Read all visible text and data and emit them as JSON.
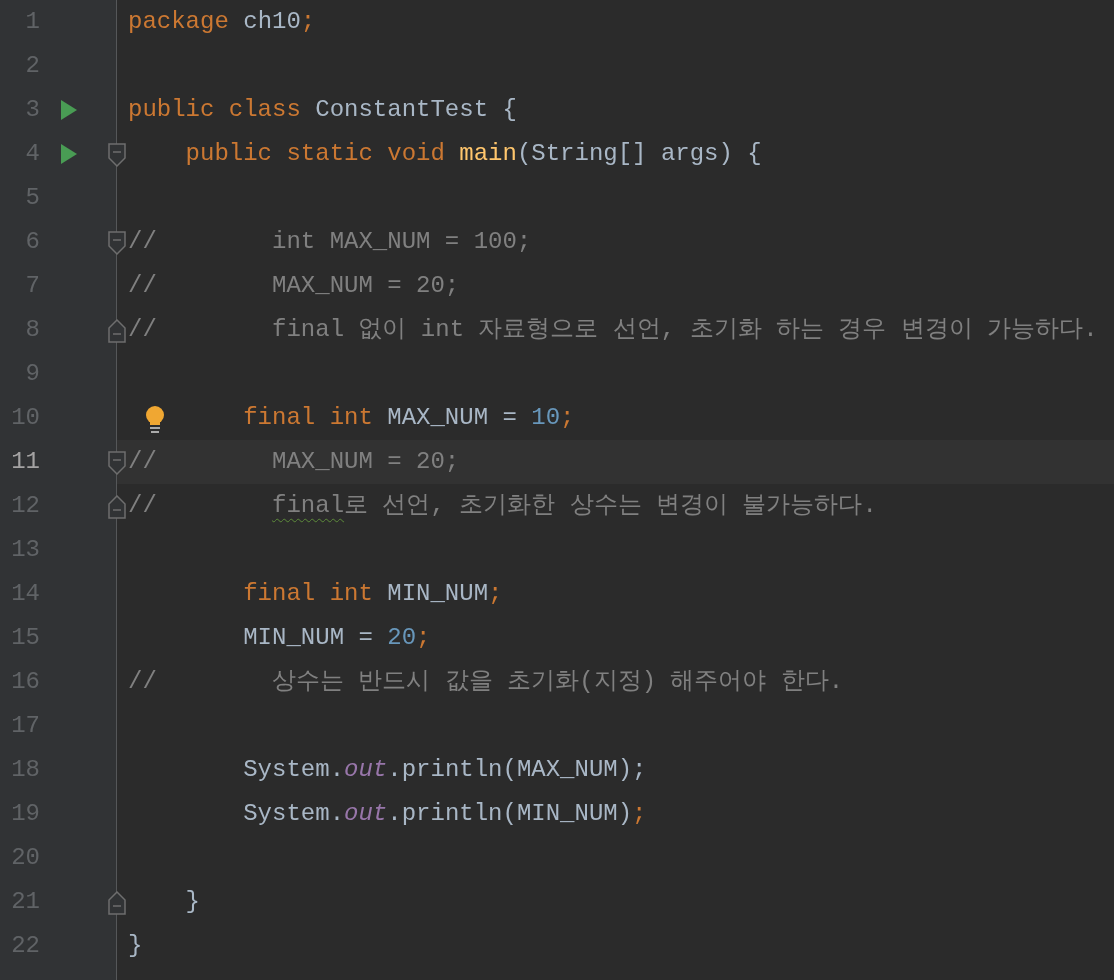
{
  "lines": [
    {
      "number": "1",
      "run": false,
      "fold_start": false,
      "fold_end": false,
      "bulb": false,
      "current": false,
      "tokens": [
        {
          "kind": "keyword",
          "text": "package"
        },
        {
          "kind": "plain",
          "text": " ch10"
        },
        {
          "kind": "punct",
          "text": ";"
        }
      ]
    },
    {
      "number": "2",
      "run": false,
      "fold_start": false,
      "fold_end": false,
      "bulb": false,
      "current": false
    },
    {
      "number": "3",
      "run": true,
      "fold_start": false,
      "fold_end": false,
      "bulb": false,
      "current": false,
      "tokens": [
        {
          "kind": "keyword",
          "text": "public class"
        },
        {
          "kind": "plain",
          "text": " ConstantTest {"
        }
      ]
    },
    {
      "number": "4",
      "run": true,
      "fold_start": true,
      "fold_end": false,
      "bulb": false,
      "current": false,
      "tokens": [
        {
          "kind": "keyword",
          "text": "    public static void"
        },
        {
          "kind": "method",
          "text": " main"
        },
        {
          "kind": "plain",
          "text": "(String[] args) {"
        }
      ]
    },
    {
      "number": "5",
      "run": false,
      "fold_start": false,
      "fold_end": false,
      "bulb": false,
      "current": false
    },
    {
      "number": "6",
      "run": false,
      "fold_start": true,
      "fold_end": false,
      "bulb": false,
      "current": false,
      "tokens": [
        {
          "kind": "comment",
          "text": "//        int MAX_NUM = 100;"
        }
      ]
    },
    {
      "number": "7",
      "run": false,
      "fold_start": false,
      "fold_end": false,
      "bulb": false,
      "current": false,
      "tokens": [
        {
          "kind": "comment",
          "text": "//        MAX_NUM = 20;"
        }
      ]
    },
    {
      "number": "8",
      "run": false,
      "fold_start": false,
      "fold_end": true,
      "bulb": false,
      "current": false,
      "tokens": [
        {
          "kind": "comment",
          "text": "//        final 없이 int 자료형으로 선언, 초기화 하는 경우 변경이 가능하다."
        }
      ]
    },
    {
      "number": "9",
      "run": false,
      "fold_start": false,
      "fold_end": false,
      "bulb": false,
      "current": false
    },
    {
      "number": "10",
      "run": false,
      "fold_start": false,
      "fold_end": false,
      "bulb": true,
      "current": false,
      "tokens": [
        {
          "kind": "keyword",
          "text": "        final int"
        },
        {
          "kind": "plain",
          "text": " MAX_NUM = "
        },
        {
          "kind": "number",
          "text": "10"
        },
        {
          "kind": "punct",
          "text": ";"
        }
      ]
    },
    {
      "number": "11",
      "run": false,
      "fold_start": true,
      "fold_end": false,
      "bulb": false,
      "current": true,
      "tokens": [
        {
          "kind": "comment",
          "text": "//        MAX_NUM = 20;"
        }
      ]
    },
    {
      "number": "12",
      "run": false,
      "fold_start": false,
      "fold_end": true,
      "bulb": false,
      "current": false,
      "tokens": [
        {
          "kind": "comment",
          "text": "//        "
        },
        {
          "kind": "comment",
          "text": "final",
          "warning": true
        },
        {
          "kind": "comment",
          "text": "로 선언, 초기화한 상수는 변경이 불가능하다."
        }
      ]
    },
    {
      "number": "13",
      "run": false,
      "fold_start": false,
      "fold_end": false,
      "bulb": false,
      "current": false
    },
    {
      "number": "14",
      "run": false,
      "fold_start": false,
      "fold_end": false,
      "bulb": false,
      "current": false,
      "tokens": [
        {
          "kind": "keyword",
          "text": "        final int"
        },
        {
          "kind": "plain",
          "text": " MIN_NUM"
        },
        {
          "kind": "punct",
          "text": ";"
        }
      ]
    },
    {
      "number": "15",
      "run": false,
      "fold_start": false,
      "fold_end": false,
      "bulb": false,
      "current": false,
      "tokens": [
        {
          "kind": "plain",
          "text": "        MIN_NUM = "
        },
        {
          "kind": "number",
          "text": "20"
        },
        {
          "kind": "punct",
          "text": ";"
        }
      ]
    },
    {
      "number": "16",
      "run": false,
      "fold_start": false,
      "fold_end": false,
      "bulb": false,
      "current": false,
      "tokens": [
        {
          "kind": "comment",
          "text": "//        상수는 반드시 값을 초기화(지정) 해주어야 한다."
        }
      ]
    },
    {
      "number": "17",
      "run": false,
      "fold_start": false,
      "fold_end": false,
      "bulb": false,
      "current": false
    },
    {
      "number": "18",
      "run": false,
      "fold_start": false,
      "fold_end": false,
      "bulb": false,
      "current": false,
      "tokens": [
        {
          "kind": "plain",
          "text": "        System."
        },
        {
          "kind": "field",
          "text": "out"
        },
        {
          "kind": "plain",
          "text": ".println(MAX_NUM);"
        }
      ]
    },
    {
      "number": "19",
      "run": false,
      "fold_start": false,
      "fold_end": false,
      "bulb": false,
      "current": false,
      "tokens": [
        {
          "kind": "plain",
          "text": "        System."
        },
        {
          "kind": "field",
          "text": "out"
        },
        {
          "kind": "plain",
          "text": ".println(MIN_NUM)"
        },
        {
          "kind": "punct",
          "text": ";"
        }
      ]
    },
    {
      "number": "20",
      "run": false,
      "fold_start": false,
      "fold_end": false,
      "bulb": false,
      "current": false
    },
    {
      "number": "21",
      "run": false,
      "fold_start": false,
      "fold_end": true,
      "bulb": false,
      "current": false,
      "tokens": [
        {
          "kind": "plain",
          "text": "    }"
        }
      ]
    },
    {
      "number": "22",
      "run": false,
      "fold_start": false,
      "fold_end": false,
      "bulb": false,
      "current": false,
      "tokens": [
        {
          "kind": "plain",
          "text": "}"
        }
      ]
    }
  ]
}
